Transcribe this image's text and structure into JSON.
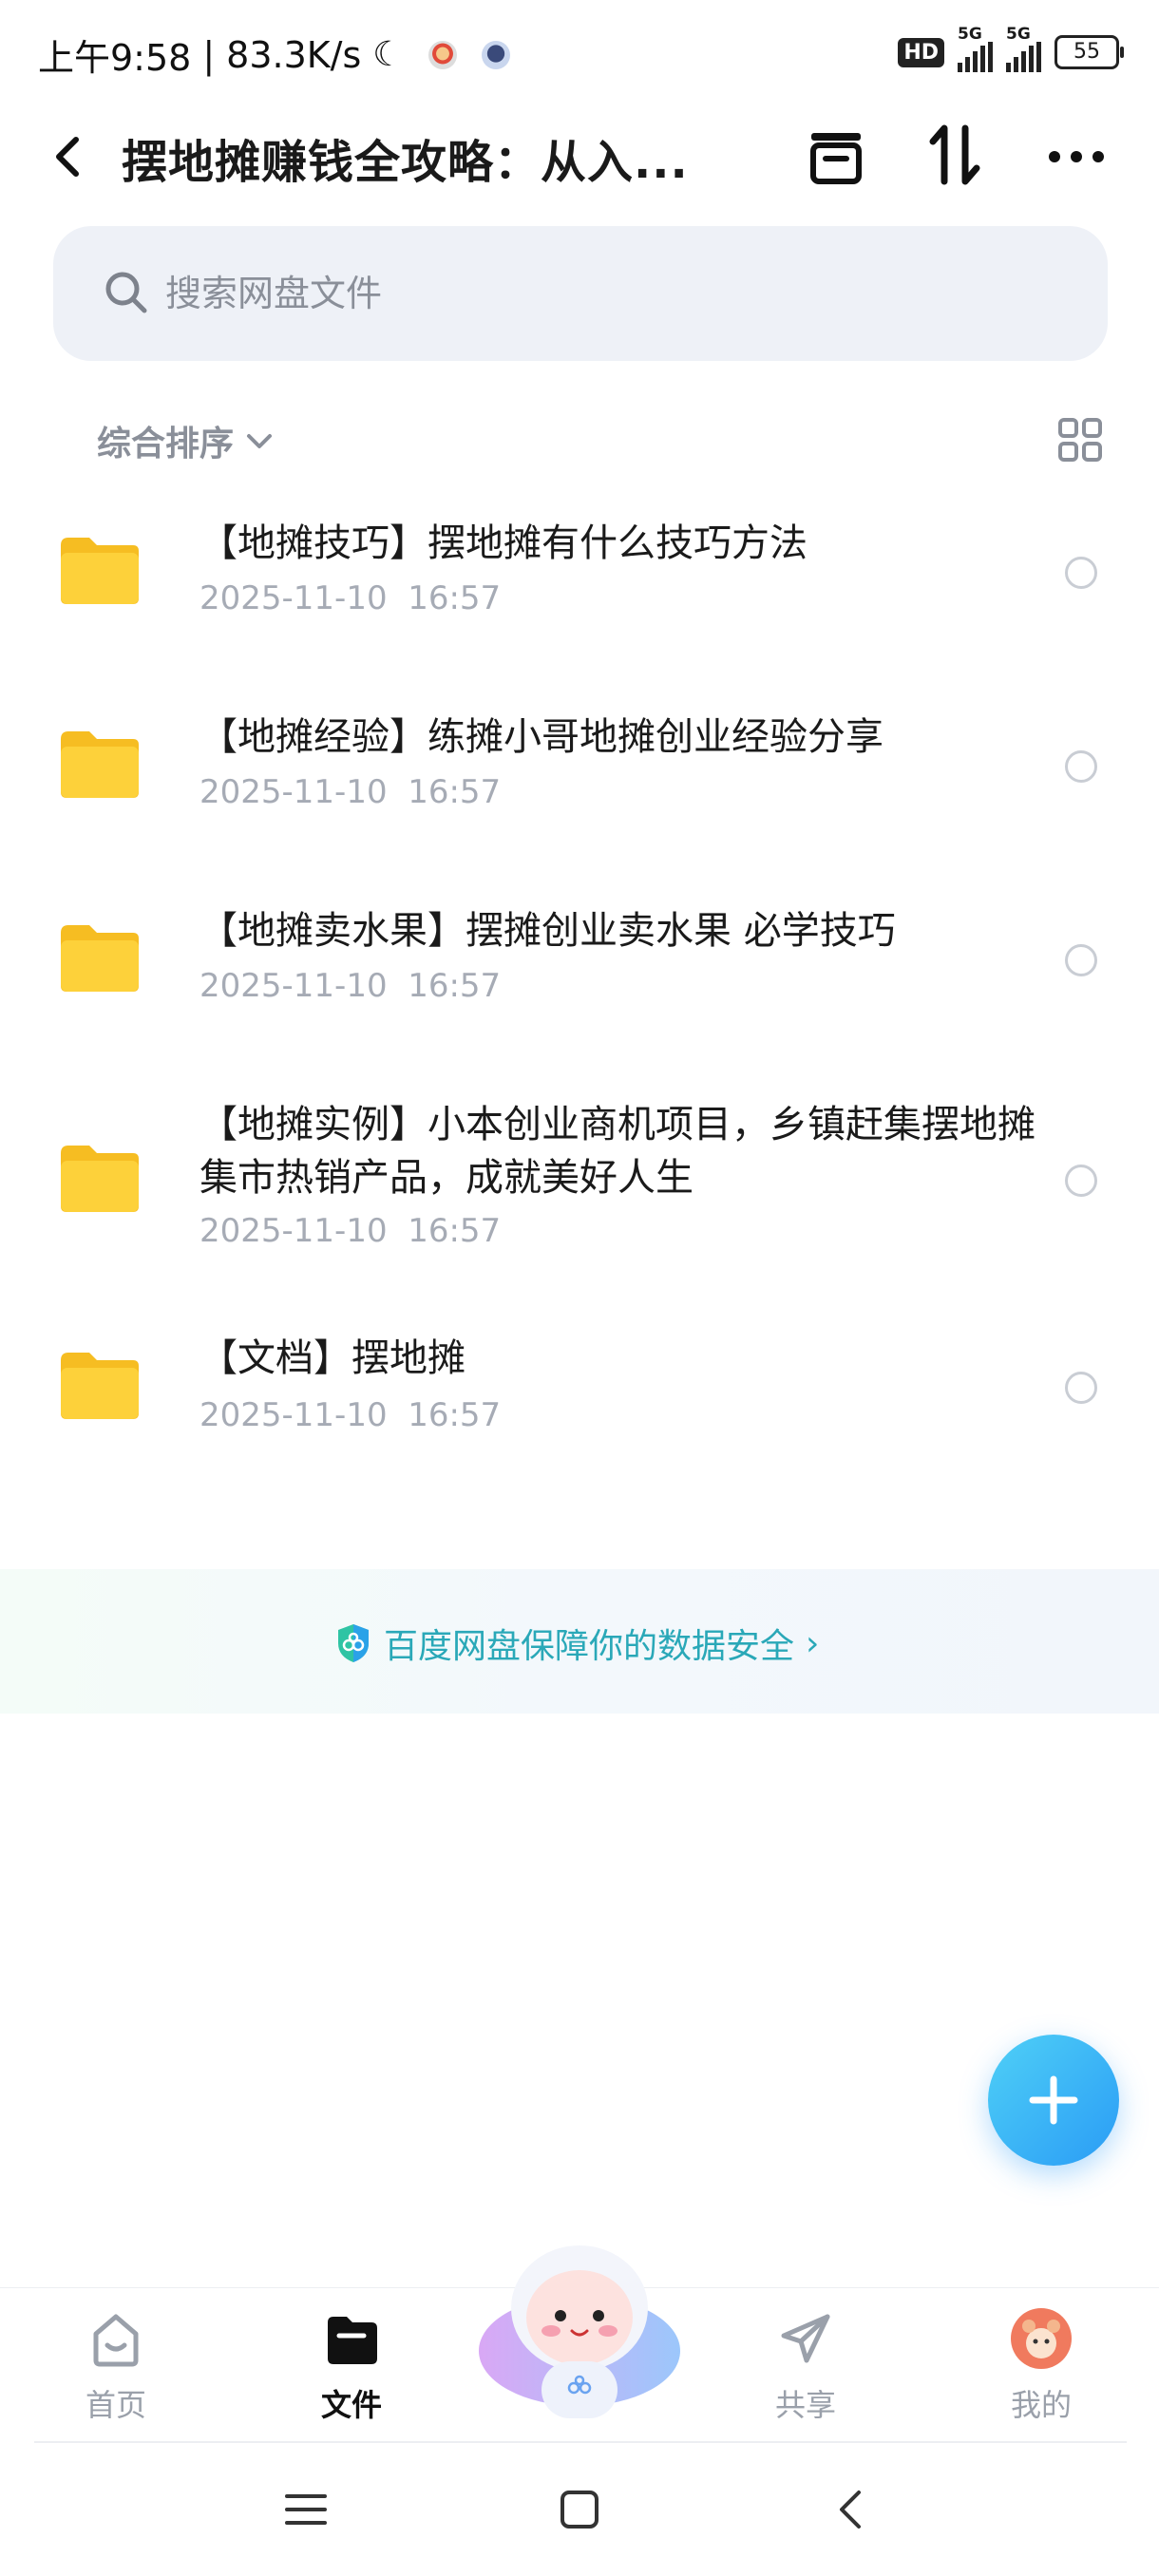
{
  "status_bar": {
    "time": "上午9:58",
    "separator": "|",
    "network_speed": "83.3K/s",
    "hd_label": "HD",
    "signal1_label": "5G",
    "signal2_label": "5G",
    "battery": "55"
  },
  "header": {
    "title": "摆地摊赚钱全攻略：从入...",
    "back_icon": "back-arrow-icon",
    "archive_icon": "archive-icon",
    "transfer_icon": "transfer-icon",
    "more_icon": "more-icon"
  },
  "search": {
    "placeholder": "搜索网盘文件"
  },
  "sort": {
    "label": "综合排序"
  },
  "files": [
    {
      "name": "【地摊技巧】摆地摊有什么技巧方法",
      "date": "2025-11-10  16:57"
    },
    {
      "name": "【地摊经验】练摊小哥地摊创业经验分享",
      "date": "2025-11-10  16:57"
    },
    {
      "name": "【地摊卖水果】摆摊创业卖水果 必学技巧",
      "date": "2025-11-10  16:57"
    },
    {
      "name": "【地摊实例】小本创业商机项目，乡镇赶集摆地摊集市热销产品，成就美好人生",
      "date": "2025-11-10  16:57"
    },
    {
      "name": "【文档】摆地摊",
      "date": "2025-11-10  16:57"
    }
  ],
  "security_banner": {
    "text": "百度网盘保障你的数据安全",
    "chevron": "›"
  },
  "bottom_nav": {
    "items": [
      {
        "label": "首页",
        "icon": "home-icon",
        "active": false
      },
      {
        "label": "文件",
        "icon": "folder-icon",
        "active": true
      },
      {
        "label": "共享",
        "icon": "share-icon",
        "active": false
      },
      {
        "label": "我的",
        "icon": "avatar-icon",
        "active": false
      }
    ]
  },
  "colors": {
    "accent": "#2a9cf5",
    "folder": "#fdd13a",
    "secure_text": "#2aa8b8",
    "notification_dot": "#f0406a"
  }
}
